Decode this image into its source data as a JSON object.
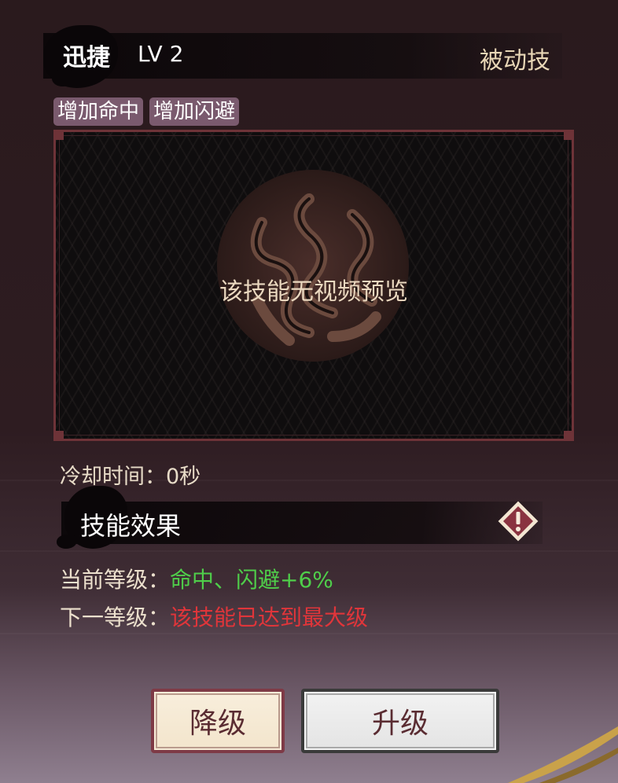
{
  "skill": {
    "name": "迅捷",
    "level_text": "LV 2",
    "type": "被动技"
  },
  "tags": [
    "增加命中",
    "增加闪避"
  ],
  "preview": {
    "message": "该技能无视频预览",
    "emblem_icon": "swirl-emblem-icon"
  },
  "cooldown": {
    "label": "冷却时间：0秒"
  },
  "effect": {
    "title": "技能效果",
    "info_icon": "warning-diamond-icon",
    "current": {
      "label": "当前等级：",
      "value": "命中、闪避+6%"
    },
    "next": {
      "label": "下一等级：",
      "value": "该技能已达到最大级"
    }
  },
  "buttons": {
    "downgrade": "降级",
    "upgrade": "升级"
  },
  "colors": {
    "accent_green": "#4fce4a",
    "accent_red": "#e0353a",
    "border_red": "#6e3338",
    "tag_bg": "#7a5a6e"
  }
}
